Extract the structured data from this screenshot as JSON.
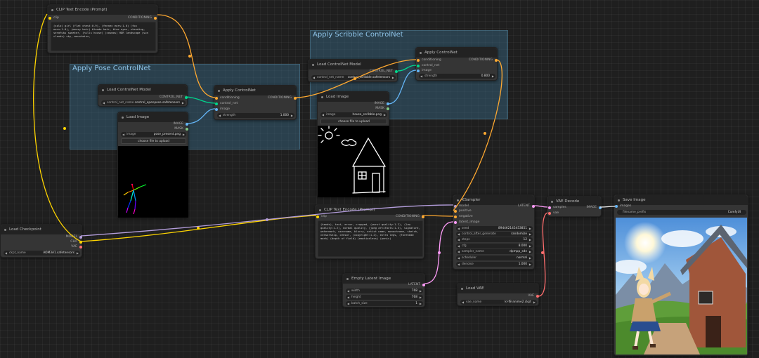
{
  "groups": {
    "pose": {
      "title": "Apply Pose ControlNet"
    },
    "scribble": {
      "title": "Apply Scribble ControlNet"
    }
  },
  "nodes": {
    "clip_pos": {
      "title": "CLIP Text Encode (Prompt)",
      "in_clip": "clip",
      "out_cond": "CONDITIONING",
      "text": "(solo) girl (flat chest:0.9), (fennec ears:1.0) (fox ears:1.0), (messy hair) blonde hair, blue eyes, standing, serafuku sweater, (hills house) (cosmos) HDR landscape (sun clouds) sky, mountains,"
    },
    "cn_model_pose": {
      "title": "Load ControlNet Model",
      "out": "CONTROL_NET",
      "w_label": "control_net_name",
      "w_value": "control_openpose.safetensors"
    },
    "img_pose": {
      "title": "Load Image",
      "out_image": "IMAGE",
      "out_mask": "MASK",
      "w_label": "image",
      "w_value": "pose_present.png",
      "btn": "choose file to upload"
    },
    "apply_pose": {
      "title": "Apply ControlNet",
      "in_cond": "conditioning",
      "in_cn": "control_net",
      "in_image": "image",
      "out": "CONDITIONING",
      "w_label": "strength",
      "w_value": "1.000"
    },
    "cn_model_scribble": {
      "title": "Load ControlNet Model",
      "out": "CONTROL_NET",
      "w_label": "control_net_name",
      "w_value": "control_scribble.safetensors"
    },
    "img_scribble": {
      "title": "Load Image",
      "out_image": "IMAGE",
      "out_mask": "MASK",
      "w_label": "image",
      "w_value": "house_scribble.png",
      "btn": "choose file to upload"
    },
    "apply_scribble": {
      "title": "Apply ControlNet",
      "in_cond": "conditioning",
      "in_cn": "control_net",
      "in_image": "image",
      "out": "CONDITIONING",
      "w_label": "strength",
      "w_value": "0.800"
    },
    "ckpt": {
      "title": "Load Checkpoint",
      "out_model": "MODEL",
      "out_clip": "CLIP",
      "out_vae": "VAE",
      "w_label": "ckpt_name",
      "w_value": "AOM3A1.safetensors"
    },
    "clip_neg": {
      "title": "CLIP Text Encode (Prompt)",
      "in_clip": "clip",
      "out_cond": "CONDITIONING",
      "text": "(hands), text, error, cropped, (worst quality:1.2), (low quality:1.2), normal quality, (jpeg artifacts:1.3), signature, watermark, username, blurry, artist name, monochrome, sketch, censorship, censor, (copyright:1.2), extra legs, (forehead mark) (depth of field) (emotionless) (penis)"
    },
    "ksampler": {
      "title": "KSampler",
      "in_model": "model",
      "in_pos": "positive",
      "in_neg": "negative",
      "in_latent": "latent_image",
      "out": "LATENT",
      "widgets": [
        {
          "label": "seed",
          "value": "894462145453851"
        },
        {
          "label": "control_after_generate",
          "value": "randomize"
        },
        {
          "label": "steps",
          "value": "12"
        },
        {
          "label": "cfg",
          "value": "8.000"
        },
        {
          "label": "sampler_name",
          "value": "dpmpp_sde"
        },
        {
          "label": "scheduler",
          "value": "normal"
        },
        {
          "label": "denoise",
          "value": "1.000"
        }
      ]
    },
    "vae_decode": {
      "title": "VAE Decode",
      "in_samples": "samples",
      "in_vae": "vae",
      "out": "IMAGE"
    },
    "save": {
      "title": "Save Image",
      "in_images": "images",
      "w_label": "filename_prefix",
      "w_value": "ComfyUI"
    },
    "empty_latent": {
      "title": "Empty Latent Image",
      "out": "LATENT",
      "widgets": [
        {
          "label": "width",
          "value": "768"
        },
        {
          "label": "height",
          "value": "768"
        },
        {
          "label": "batch_size",
          "value": "1"
        }
      ]
    },
    "load_vae": {
      "title": "Load VAE",
      "out": "VAE",
      "w_label": "vae_name",
      "w_value": "kl-f8-anime2.ckpt"
    }
  },
  "colors": {
    "canvas": "#1f1f1f",
    "conditioning": "#ffa931",
    "clip": "#ffd500",
    "model": "#b39ddb",
    "vae": "#ff6e6e",
    "latent": "#ff9cf9",
    "image": "#64b5f6",
    "control_net": "#00d78d"
  }
}
